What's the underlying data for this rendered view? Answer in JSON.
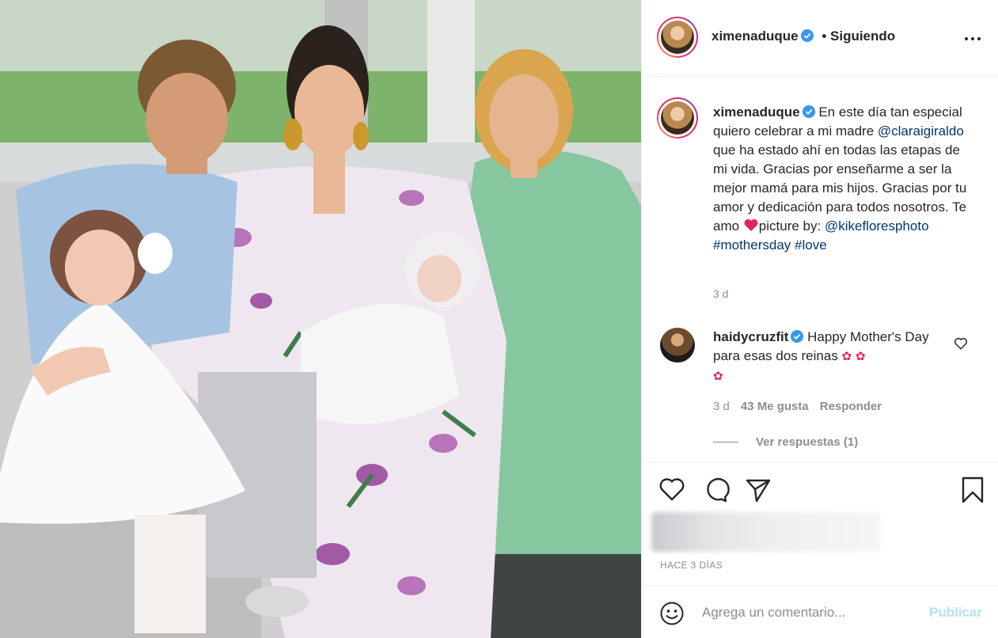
{
  "post": {
    "author": "ximenaduque",
    "follow_status": "• Siguiendo"
  },
  "caption": {
    "username": "ximenaduque",
    "text_1": " En este día tan especial quiero celebrar a mi madre ",
    "mention_1": "@claraigiraldo",
    "text_2": " que ha estado ahí en todas las etapas de mi vida. Gracias por enseñarme a ser la mejor mamá para mis hijos. Gracias por tu amor y dedicación para todos nosotros. Te amo ",
    "text_3": "picture by: ",
    "mention_2": "@kikefloresphoto",
    "hashtag_1": "#mothersday",
    "hashtag_2": "#love",
    "time": "3 d"
  },
  "comment": {
    "username": "haidycruzfit",
    "text": " Happy Mother's Day para esas dos reinas ",
    "emoji_1": "✿",
    "emoji_2": "✿",
    "emoji_3": "✿",
    "time": "3 d",
    "likes": "43 Me gusta",
    "reply": "Responder",
    "view_replies": "Ver respuestas (1)"
  },
  "footer": {
    "date": "HACE 3 DÍAS",
    "comment_placeholder": "Agrega un comentario...",
    "publish": "Publicar"
  },
  "colors": {
    "link": "#00376b",
    "muted": "#8e8e8e",
    "verified": "#3897f0",
    "publish_disabled": "#b2dffc",
    "heart": "#e0245e"
  },
  "icons": {
    "verified": "verified-badge-icon",
    "more": "more-options-icon",
    "heart": "heart-icon",
    "comment": "comment-bubble-icon",
    "share": "paper-plane-icon",
    "save": "bookmark-icon",
    "emoji": "emoji-smiley-icon",
    "red_heart": "red-heart-emoji-icon"
  }
}
